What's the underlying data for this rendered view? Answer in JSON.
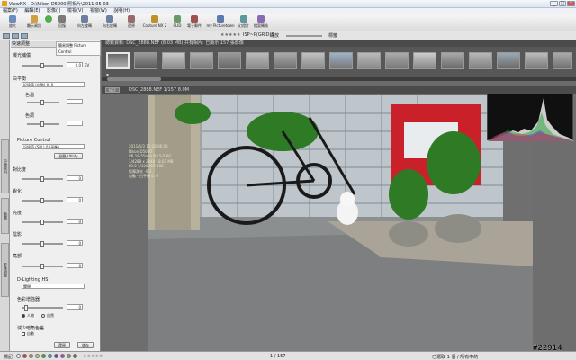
{
  "window": {
    "title": "ViewNX - D:\\Nikon D5000 照相片\\2011-05-03",
    "min": "_",
    "max": "□",
    "close": "x"
  },
  "menu": [
    "檔案(F)",
    "編輯(E)",
    "影像(I)",
    "檢視(V)",
    "視窗(W)",
    "說明(H)"
  ],
  "toolbar": [
    {
      "label": "放大",
      "color": "#6a8cc0"
    },
    {
      "label": "顯示資訊",
      "color": "#d0a040"
    },
    {
      "label": "",
      "color": "#4fae4f"
    },
    {
      "label": "回復",
      "color": "#7a7a7a"
    },
    {
      "label": "向左旋轉",
      "color": "#6d7fa0"
    },
    {
      "label": "向右旋轉",
      "color": "#6d7fa0"
    },
    {
      "label": "還原",
      "color": "#9a6a6a"
    },
    {
      "label": "Capture NX 2",
      "color": "#c0902a"
    },
    {
      "label": "PLID",
      "color": "#6a9a6a"
    },
    {
      "label": "電子郵件",
      "color": "#a05050"
    },
    {
      "label": "my Picturetown",
      "color": "#5a7ab0"
    },
    {
      "label": "幻燈片",
      "color": "#5a9a9a"
    },
    {
      "label": "檔案轉換",
      "color": "#8a6ab0"
    }
  ],
  "toolbar2": {
    "zoom": "縮放",
    "rating": "★★★★★",
    "tag": "標籤",
    "mode": "ISP~P(GRID)S"
  },
  "left": {
    "tab_left": "快速調整",
    "tab_right": "簡易調整 Picture Control",
    "side_tabs": [
      "中繼資料",
      "動畫",
      "影像調整"
    ],
    "exposure_label": "曝光補償",
    "exposure_value": "0.0",
    "exposure_unit": "EV",
    "wb_label": "白平衡",
    "wb_value": "記錄值 (自動) 0, 0",
    "temp_label": "色溫",
    "tint_label": "色調",
    "pc_label": "Picture Control",
    "pc_value": "記錄值 (SPL) 0 (平衡)",
    "pc_button": "副觀/Utility",
    "sliders": [
      {
        "label": "對比度",
        "value": "0"
      },
      {
        "label": "銳化",
        "value": "0"
      },
      {
        "label": "亮度",
        "value": "0"
      },
      {
        "label": "陰影",
        "value": "0"
      },
      {
        "label": "亮部",
        "value": "0"
      }
    ],
    "dl_label": "D-Lighting HS",
    "dl_value": "關閉",
    "color_label": "色彩增強器",
    "color_value": "0",
    "radio1": "人物",
    "radio2": "自然",
    "extra_label": "減少暗角色差",
    "extra_check": "自動",
    "btn_reset": "還原",
    "btn_save": "儲存"
  },
  "filmstrip": {
    "header": "總數資料: DSC_2888.NEF (8.03 MB) 共有相片: 已顯示 157 張影像"
  },
  "viewer": {
    "header": "DSC_2888.NEF 1/157 8.0M",
    "mode": "NEF"
  },
  "info": [
    "2011/5/3 11:26:06.00",
    "Nikon D5000",
    "VR 18-55mm f/3.5-5.6G",
    "1/4288 x 2848 - 8.03 MB",
    "F8.0 1/320 ISO 200",
    "矩陣測光 -0.3",
    "自動 - 白平衡 0, 0"
  ],
  "status": {
    "left": "標記",
    "center": "1 / 157",
    "right": "已選取 1 個 / 所有中的"
  },
  "label_colors": [
    "#ffffff",
    "#d33",
    "#e80",
    "#ec3",
    "#3a3",
    "#39c",
    "#63c",
    "#c3c",
    "#999",
    "#663"
  ],
  "watermark": "#22914"
}
